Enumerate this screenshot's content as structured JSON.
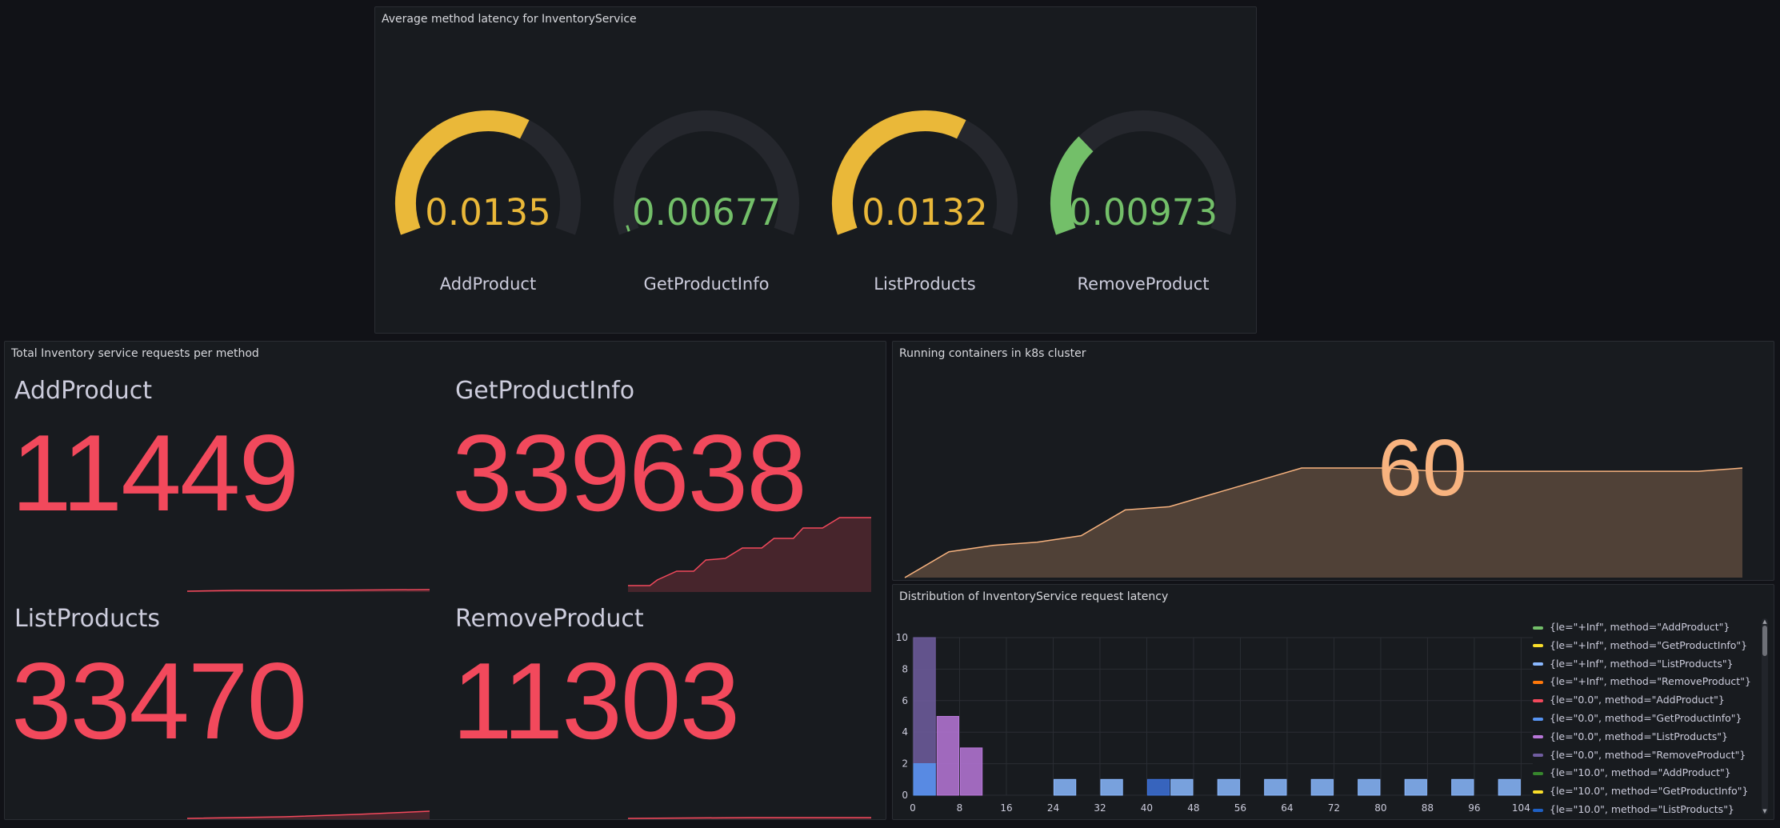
{
  "panels": {
    "latency_gauges": {
      "title": "Average method latency for InventoryService",
      "gauges": [
        {
          "label": "AddProduct",
          "value": "0.0135",
          "fraction": 0.62,
          "color": "#eab839"
        },
        {
          "label": "GetProductInfo",
          "value": "0.00677",
          "fraction": 0.02,
          "color": "#73bf69"
        },
        {
          "label": "ListProducts",
          "value": "0.0132",
          "fraction": 0.62,
          "color": "#eab839"
        },
        {
          "label": "RemoveProduct",
          "value": "0.00973",
          "fraction": 0.3,
          "color": "#73bf69"
        }
      ]
    },
    "total_requests": {
      "title": "Total Inventory service requests per method",
      "stats": [
        {
          "label": "AddProduct",
          "value": "11449"
        },
        {
          "label": "GetProductInfo",
          "value": "339638"
        },
        {
          "label": "ListProducts",
          "value": "33470"
        },
        {
          "label": "RemoveProduct",
          "value": "11303"
        }
      ],
      "color": "#f2495c"
    },
    "containers": {
      "title": "Running containers in k8s cluster",
      "value": "60",
      "color": "#f8b37f"
    },
    "latency_distribution": {
      "title": "Distribution of InventoryService request latency",
      "legend": [
        {
          "label": "{le=\"+Inf\", method=\"AddProduct\"}",
          "color": "#73bf69"
        },
        {
          "label": "{le=\"+Inf\", method=\"GetProductInfo\"}",
          "color": "#fade2a"
        },
        {
          "label": "{le=\"+Inf\", method=\"ListProducts\"}",
          "color": "#8ab8ff"
        },
        {
          "label": "{le=\"+Inf\", method=\"RemoveProduct\"}",
          "color": "#ff780a"
        },
        {
          "label": "{le=\"0.0\", method=\"AddProduct\"}",
          "color": "#f2495c"
        },
        {
          "label": "{le=\"0.0\", method=\"GetProductInfo\"}",
          "color": "#5794f2"
        },
        {
          "label": "{le=\"0.0\", method=\"ListProducts\"}",
          "color": "#b877d9"
        },
        {
          "label": "{le=\"0.0\", method=\"RemoveProduct\"}",
          "color": "#705da0"
        },
        {
          "label": "{le=\"10.0\", method=\"AddProduct\"}",
          "color": "#37872d"
        },
        {
          "label": "{le=\"10.0\", method=\"GetProductInfo\"}",
          "color": "#fade2a"
        },
        {
          "label": "{le=\"10.0\", method=\"ListProducts\"}",
          "color": "#1f60c4"
        }
      ]
    }
  },
  "chart_data": [
    {
      "type": "area",
      "x": [
        0,
        1,
        2,
        3,
        4,
        5,
        6,
        7,
        8,
        9,
        10,
        11,
        12,
        13,
        14,
        15,
        16,
        17,
        18,
        19
      ],
      "values": [
        40,
        44,
        45,
        45.5,
        46.5,
        50.5,
        51,
        53,
        55,
        57,
        57,
        57,
        56.5,
        56.5,
        56.5,
        56.5,
        56.5,
        56.5,
        56.5,
        57
      ],
      "ylim": [
        40,
        58
      ],
      "color": "#f8b37f"
    },
    {
      "type": "bar",
      "ylim": [
        0,
        10
      ],
      "yticks": [
        0,
        2,
        4,
        6,
        8,
        10
      ],
      "xticks": [
        0,
        8,
        16,
        24,
        32,
        40,
        48,
        56,
        64,
        72,
        80,
        88,
        96,
        104
      ],
      "bars": [
        {
          "x0": 0,
          "x1": 4,
          "value": 10,
          "color": "#705da0"
        },
        {
          "x0": 0,
          "x1": 4,
          "value": 2,
          "color": "#5794f2"
        },
        {
          "x0": 4,
          "x1": 8,
          "value": 5,
          "color": "#b877d9"
        },
        {
          "x0": 8,
          "x1": 12,
          "value": 3,
          "color": "#b877d9"
        },
        {
          "x0": 24,
          "x1": 28,
          "value": 1,
          "color": "#8ab8ff"
        },
        {
          "x0": 32,
          "x1": 36,
          "value": 1,
          "color": "#8ab8ff"
        },
        {
          "x0": 40,
          "x1": 44,
          "value": 1,
          "color": "#3d71d9"
        },
        {
          "x0": 44,
          "x1": 48,
          "value": 1,
          "color": "#8ab8ff"
        },
        {
          "x0": 52,
          "x1": 56,
          "value": 1,
          "color": "#8ab8ff"
        },
        {
          "x0": 60,
          "x1": 64,
          "value": 1,
          "color": "#8ab8ff"
        },
        {
          "x0": 68,
          "x1": 72,
          "value": 1,
          "color": "#8ab8ff"
        },
        {
          "x0": 76,
          "x1": 80,
          "value": 1,
          "color": "#8ab8ff"
        },
        {
          "x0": 84,
          "x1": 88,
          "value": 1,
          "color": "#8ab8ff"
        },
        {
          "x0": 92,
          "x1": 96,
          "value": 1,
          "color": "#8ab8ff"
        },
        {
          "x0": 100,
          "x1": 104,
          "value": 1,
          "color": "#8ab8ff"
        }
      ]
    }
  ]
}
